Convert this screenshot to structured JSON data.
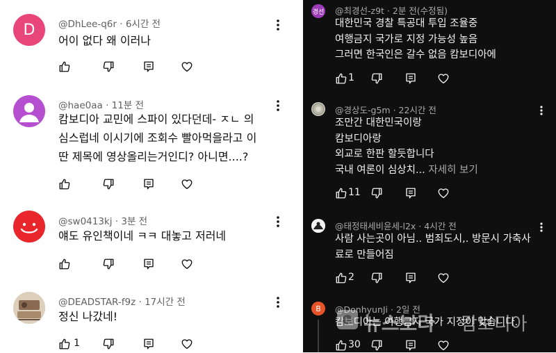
{
  "left_comments": [
    {
      "author": "@DhLee-q6r",
      "time": "· 6시간 전",
      "text": "어이 없다 왜 이러나",
      "avatar_letter": "D",
      "avatar_color": "#e8467a",
      "likes": ""
    },
    {
      "author": "@hae0aa",
      "time": "· 11분 전",
      "text": "캄보디아 교민에 스파이 있다던데- ㅈㄴ 의\n심스럽네 이시기에 조회수 빨아먹을라고 이\n딴 제목에 영상올리는거인디? 아니면....?",
      "avatar_color": "#b54fcf",
      "likes": ""
    },
    {
      "author": "@sw0413kj",
      "time": "· 3분 전",
      "text": "얘도 유인책이네 ㅋㅋ 대놓고 저러네",
      "avatar_color": "#e8262b",
      "likes": ""
    },
    {
      "author": "@DEADSTAR-f9z",
      "time": "· 17시간 전",
      "text": "정신 나갔네!",
      "avatar_color": "#d8c9b4",
      "likes": "1"
    }
  ],
  "right_comments": [
    {
      "author": "@최경선-z9t",
      "time": "· 2분 전(수정됨)",
      "text": "대한민국 경찰 특공대 투입 조율중\n여행금지 국가로 지정 가능성 높음\n그러면 한국인은 갈수 없음 캄보디아에",
      "avatar_label": "경선",
      "avatar_color": "#9c3bb8",
      "likes": "1"
    },
    {
      "author": "@경상도-g5m",
      "time": "· 22시간 전",
      "text": "조만간 대한민국이랑\n캄보디아랑\n외교로 한판 할듯합니다\n국내 여론이 심상치...",
      "more_label": "자세히 보기",
      "avatar_color": "#cfcfc6",
      "likes": "11"
    },
    {
      "author": "@태정태세비윤세-l2x",
      "time": "· 4시간 전",
      "text": "사람 사는곳이 아님.. 범죄도시,. 방문시 가축사\n료로 만들어짐",
      "avatar_color": "#e6e6e6",
      "likes": "2"
    },
    {
      "author": "@DonhyunJi",
      "time": "· 2일 전",
      "text": "캄보디아는 여행금지 국가 지정이 맞습니다.",
      "avatar_letter": "B",
      "avatar_color": "#e8542a",
      "likes": "30"
    }
  ],
  "watermark": {
    "brand": "뉴스보라",
    "suffix": "캄보디아"
  },
  "colors": {
    "light_bg": "#ffffff",
    "dark_bg": "#0f0f0f",
    "light_text": "#0f0f0f",
    "muted": "#606060",
    "dark_text": "#f1f1f1",
    "dark_muted": "#aaaaaa"
  }
}
